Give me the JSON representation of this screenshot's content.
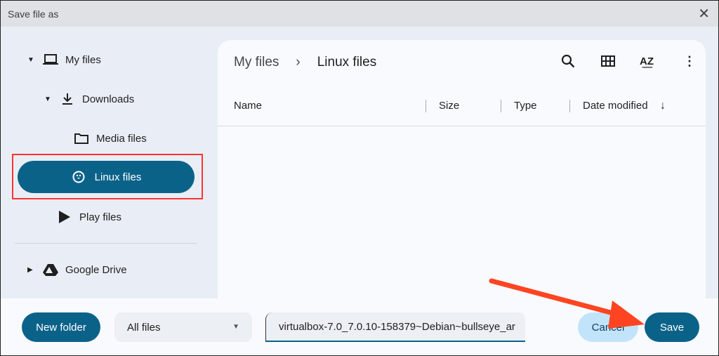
{
  "dialog": {
    "title": "Save file as"
  },
  "sidebar": {
    "items": [
      {
        "label": "My files",
        "icon": "laptop-icon"
      },
      {
        "label": "Downloads",
        "icon": "download-icon"
      },
      {
        "label": "Media files",
        "icon": "folder-icon"
      },
      {
        "label": "Linux files",
        "icon": "penguin-icon",
        "selected": true
      },
      {
        "label": "Play files",
        "icon": "play-icon"
      },
      {
        "label": "Google Drive",
        "icon": "drive-icon"
      }
    ]
  },
  "main": {
    "breadcrumb": [
      "My files",
      "Linux files"
    ],
    "columns": [
      "Name",
      "Size",
      "Type",
      "Date modified"
    ]
  },
  "footer": {
    "new_folder": "New folder",
    "filter": "All files",
    "filename": "virtualbox-7.0_7.0.10-158379~Debian~bullseye_ar",
    "cancel": "Cancel",
    "save": "Save"
  },
  "colors": {
    "accent": "#0b6289",
    "highlight": "#ff3322"
  }
}
